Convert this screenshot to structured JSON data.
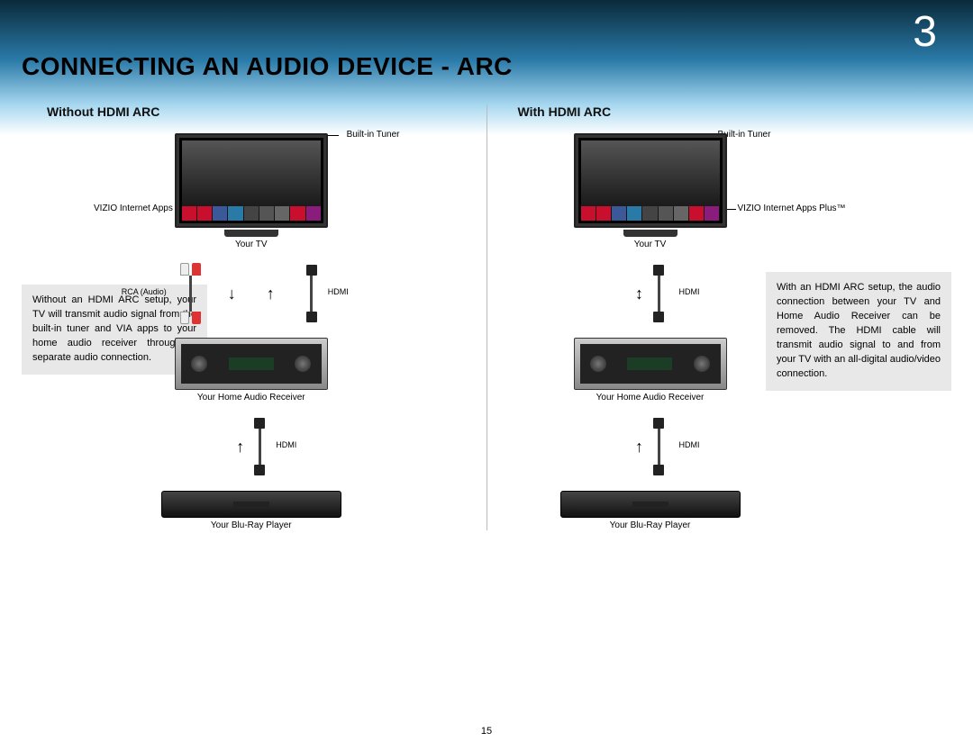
{
  "page_number_top": "3",
  "page_number_bottom": "15",
  "title": "CONNECTING AN AUDIO DEVICE - ARC",
  "left": {
    "subtitle": "Without HDMI ARC",
    "infobox": "Without an HDMI ARC setup, your TV will transmit audio signal from the built-in tuner and VIA apps to your home audio receiver through a separate audio connection.",
    "tuner_label": "Built-in Tuner",
    "apps_label": "VIZIO Internet Apps Plus™",
    "tv_caption": "Your TV",
    "rca_label": "RCA (Audio)",
    "hdmi_label_top": "HDMI",
    "receiver_caption": "Your Home Audio Receiver",
    "hdmi_label_bottom": "HDMI",
    "bluray_caption": "Your Blu-Ray Player"
  },
  "right": {
    "subtitle": "With HDMI ARC",
    "infobox": "With an HDMI ARC setup, the audio connection between your TV and Home Audio Receiver can be removed. The HDMI cable will transmit audio signal to and from your TV with an all-digital audio/video connection.",
    "tuner_label": "Built-in Tuner",
    "apps_label": "VIZIO Internet Apps Plus™",
    "tv_caption": "Your TV",
    "hdmi_label_top": "HDMI",
    "receiver_caption": "Your Home Audio Receiver",
    "hdmi_label_bottom": "HDMI",
    "bluray_caption": "Your Blu-Ray Player"
  },
  "app_colors": [
    "#c8102e",
    "#c8102e",
    "#3b5998",
    "#2a7aa8",
    "#444",
    "#555",
    "#666",
    "#c8102e",
    "#8a1c7b"
  ]
}
